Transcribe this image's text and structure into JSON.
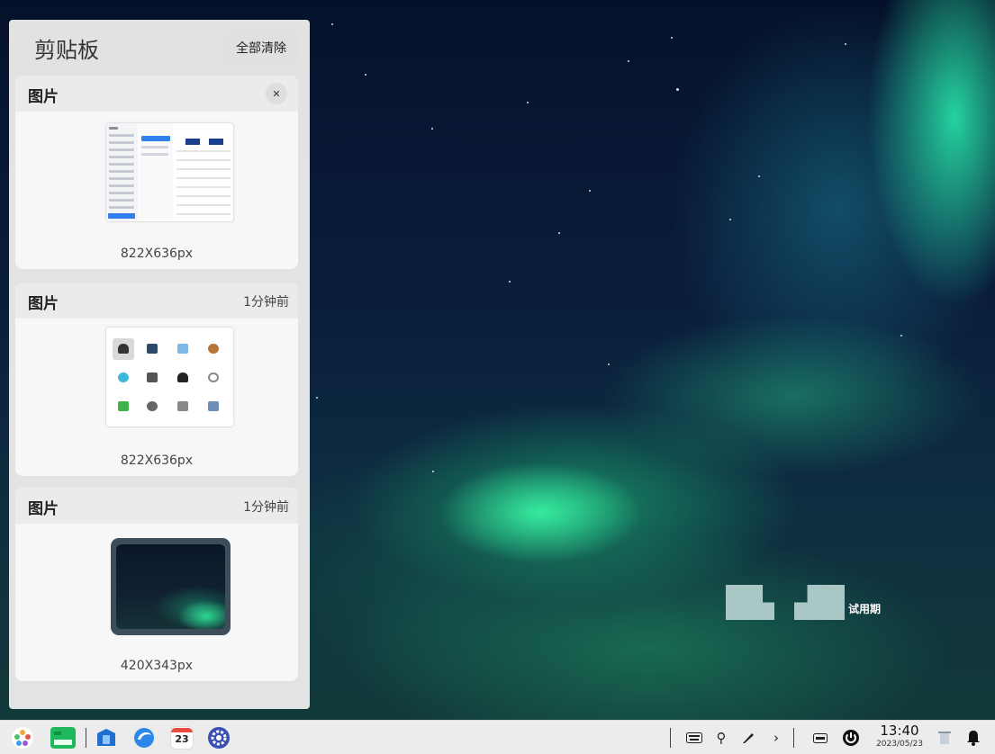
{
  "clipboard": {
    "title": "剪贴板",
    "clear_all_label": "全部清除",
    "items": [
      {
        "type": "图片",
        "time": "",
        "size": "822X636px"
      },
      {
        "type": "图片",
        "time": "1分钟前",
        "size": "822X636px"
      },
      {
        "type": "图片",
        "time": "1分钟前",
        "size": "420X343px"
      }
    ]
  },
  "desktop": {
    "watermark_label": "试用期"
  },
  "taskbar": {
    "apps": [
      "launcher-icon",
      "file-manager-icon",
      "app-store-icon",
      "browser-icon",
      "calendar-icon",
      "settings-icon"
    ],
    "calendar_day": "23",
    "tray": [
      "keyboard-icon",
      "usb-icon",
      "pen-icon",
      "expand-arrow-icon",
      "keyboard-layout-icon",
      "power-icon",
      "trash-icon",
      "notification-icon"
    ],
    "time": "13:40",
    "date": "2023/05/23"
  },
  "colors": {
    "accent": "#2f80ed",
    "panel_bg": "#ebebeb",
    "taskbar_bg": "#ececec"
  }
}
